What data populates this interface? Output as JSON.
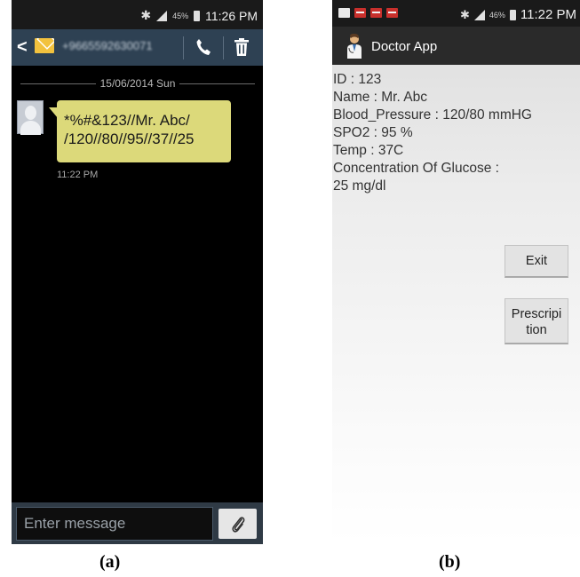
{
  "panel_a": {
    "caption": "(a)",
    "status": {
      "battery": "45%",
      "time": "11:26 PM"
    },
    "header": {
      "contact": "+9665592630071"
    },
    "date_separator": "15/06/2014 Sun",
    "message": {
      "text": "*%#&123//Mr. Abc/\n/120//80//95//37//25",
      "time": "11:22 PM"
    },
    "compose": {
      "placeholder": "Enter message"
    }
  },
  "panel_b": {
    "caption": "(b)",
    "status": {
      "battery": "46%",
      "time": "11:22 PM"
    },
    "app_title": "Doctor App",
    "info_lines": [
      "ID : 123",
      "Name : Mr. Abc",
      "Blood_Pressure : 120/80 mmHG",
      "SPO2 : 95 %",
      "Temp : 37C",
      "Concentration Of Glucose :",
      "25 mg/dl"
    ],
    "buttons": {
      "exit": "Exit",
      "prescription_line1": "Prescripi",
      "prescription_line2": "tion"
    }
  }
}
